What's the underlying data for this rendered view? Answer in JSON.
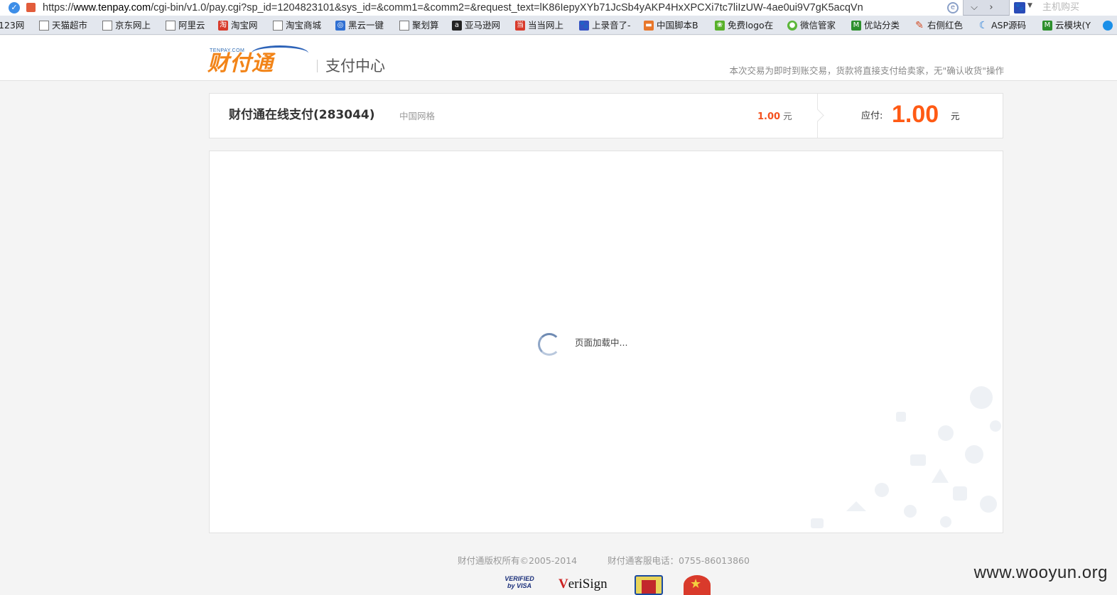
{
  "browser": {
    "url_prefix": "https://",
    "url_host": "www.tenpay.com",
    "url_path": "/cgi-bin/v1.0/pay.cgi?sp_id=1204823101&sys_id=&comm1=&comm2=&request_text=lK86IepyXYb71JcSb4yAKP4HxXPCXi7tc7liIzUW-4ae0ui9V7gK5acqVn",
    "search_placeholder": "主机购买"
  },
  "bookmarks": [
    {
      "label": "123网",
      "icon": "page-icon"
    },
    {
      "label": "天猫超市",
      "icon": "page-icon"
    },
    {
      "label": "京东网上",
      "icon": "page-icon"
    },
    {
      "label": "阿里云",
      "icon": "page-icon"
    },
    {
      "label": "淘宝网",
      "icon": "taobao-icon"
    },
    {
      "label": "淘宝商城",
      "icon": "page-icon"
    },
    {
      "label": "黑云一键",
      "icon": "heiyun-icon"
    },
    {
      "label": "聚划算",
      "icon": "page-icon"
    },
    {
      "label": "亚马逊网",
      "icon": "amazon-icon"
    },
    {
      "label": "当当网上",
      "icon": "dangdang-icon"
    },
    {
      "label": "上录音了-",
      "icon": "baidu-icon"
    },
    {
      "label": "中国脚本B",
      "icon": "cart-icon"
    },
    {
      "label": "免费logo在",
      "icon": "leaf-icon"
    },
    {
      "label": "微信管家",
      "icon": "wechat-icon"
    },
    {
      "label": "优站分类",
      "icon": "m-icon"
    },
    {
      "label": "右侧红色",
      "icon": "pencil-icon"
    },
    {
      "label": "ASP源码",
      "icon": "moon-icon"
    },
    {
      "label": "云模块(Y",
      "icon": "m-icon"
    }
  ],
  "header": {
    "logo_en": "TENPAY.COM",
    "logo_cn": "财付通",
    "subtitle": "支付中心",
    "note": "本次交易为即时到账交易，货款将直接支付给卖家，无\"确认收货\"操作"
  },
  "order": {
    "title": "财付通在线支付(283044)",
    "merchant": "中国网格",
    "amount": "1.00",
    "amount_unit": "元",
    "due_label": "应付:",
    "due_value": "1.00",
    "due_unit": "元"
  },
  "content": {
    "loading_text": "页面加载中..."
  },
  "footer": {
    "copyright": "财付通版权所有©2005-2014",
    "phone": "财付通客服电话：0755-86013860",
    "badge_visa": "VERIFIED by VISA",
    "badge_verisign_v": "V",
    "badge_verisign_rest": "eriSign"
  },
  "watermark": "www.wooyun.org",
  "colors": {
    "accent_orange": "#ff5a14",
    "logo_orange": "#f28418",
    "logo_blue": "#2d63b8"
  }
}
